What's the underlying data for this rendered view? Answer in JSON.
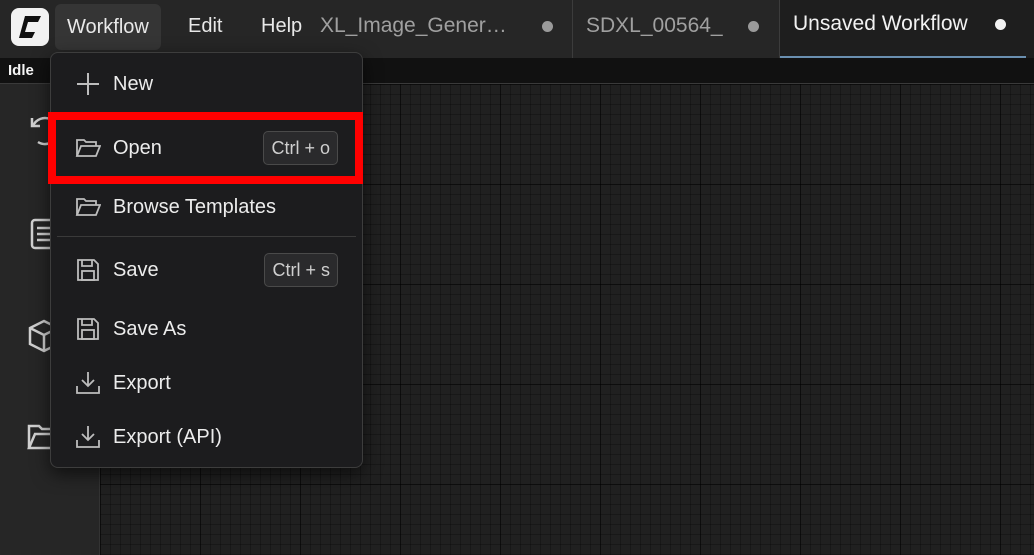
{
  "app": {
    "logo_letter": "C",
    "status": "Idle"
  },
  "menubar": {
    "items": [
      {
        "label": "Workflow"
      },
      {
        "label": "Edit"
      },
      {
        "label": "Help"
      }
    ]
  },
  "tabs": [
    {
      "label": "XL_Image_Gener…"
    },
    {
      "label": "SDXL_00564_"
    },
    {
      "label": "Unsaved Workflow"
    }
  ],
  "workflow_menu": {
    "items": [
      {
        "label": "New",
        "icon": "plus-icon"
      },
      {
        "label": "Open",
        "icon": "folder-open-icon",
        "shortcut": "Ctrl + o"
      },
      {
        "label": "Browse Templates",
        "icon": "folder-open-icon"
      },
      {
        "label": "Save",
        "icon": "floppy-disk-icon",
        "shortcut": "Ctrl + s"
      },
      {
        "label": "Save As",
        "icon": "floppy-disk-icon"
      },
      {
        "label": "Export",
        "icon": "download-icon"
      },
      {
        "label": "Export (API)",
        "icon": "download-icon"
      }
    ]
  },
  "colors": {
    "highlight": "#ff0000",
    "tab_active_underline": "#6a8fb0"
  }
}
